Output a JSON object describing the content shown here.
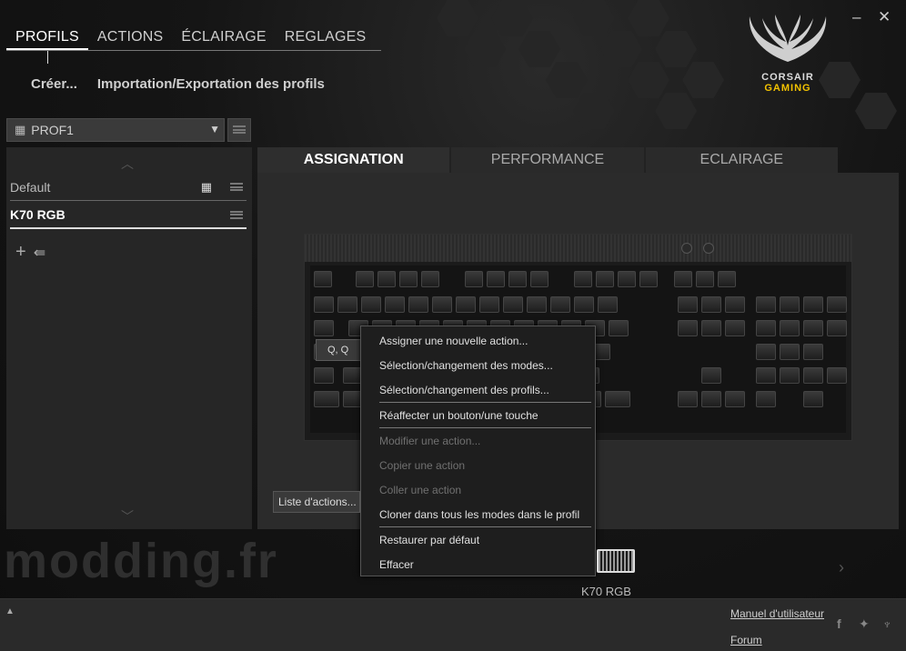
{
  "window": {
    "minimize_glyph": "–",
    "close_glyph": "✕"
  },
  "topnav": {
    "tabs": [
      {
        "label": "PROFILS",
        "active": true
      },
      {
        "label": "ACTIONS"
      },
      {
        "label": "ÉCLAIRAGE"
      },
      {
        "label": "REGLAGES"
      }
    ]
  },
  "subnav": {
    "create": "Créer...",
    "import_export": "Importation/Exportation des profils"
  },
  "logo": {
    "line1": "CORSAIR",
    "line2": "GAMING",
    "accent_color": "#f2c200"
  },
  "profile_selector": {
    "value": "PROF1"
  },
  "profiles": {
    "items": [
      {
        "label": "Default"
      },
      {
        "label": "K70 RGB",
        "selected": true
      }
    ]
  },
  "right_tabs": [
    {
      "label": "ASSIGNATION",
      "active": true
    },
    {
      "label": "PERFORMANCE"
    },
    {
      "label": "ECLAIRAGE"
    }
  ],
  "key_tooltip": "Q, Q",
  "context_menu": {
    "items": [
      {
        "label": "Assigner une nouvelle action..."
      },
      {
        "label": "Sélection/changement des modes..."
      },
      {
        "label": "Sélection/changement des profils..."
      },
      {
        "label": "Réaffecter un bouton/une touche"
      },
      {
        "label": "Modifier une action...",
        "disabled": true
      },
      {
        "label": "Copier une action",
        "disabled": true
      },
      {
        "label": "Coller une action",
        "disabled": true
      },
      {
        "label": "Cloner dans tous les modes dans le profil"
      },
      {
        "label": "Restaurer par défaut"
      },
      {
        "label": "Effacer"
      }
    ]
  },
  "actions_list_button": "Liste d'actions...",
  "watermark": "modding.fr",
  "device": {
    "label": "K70 RGB"
  },
  "footer": {
    "manual": "Manuel d'utilisateur",
    "forum": "Forum"
  }
}
